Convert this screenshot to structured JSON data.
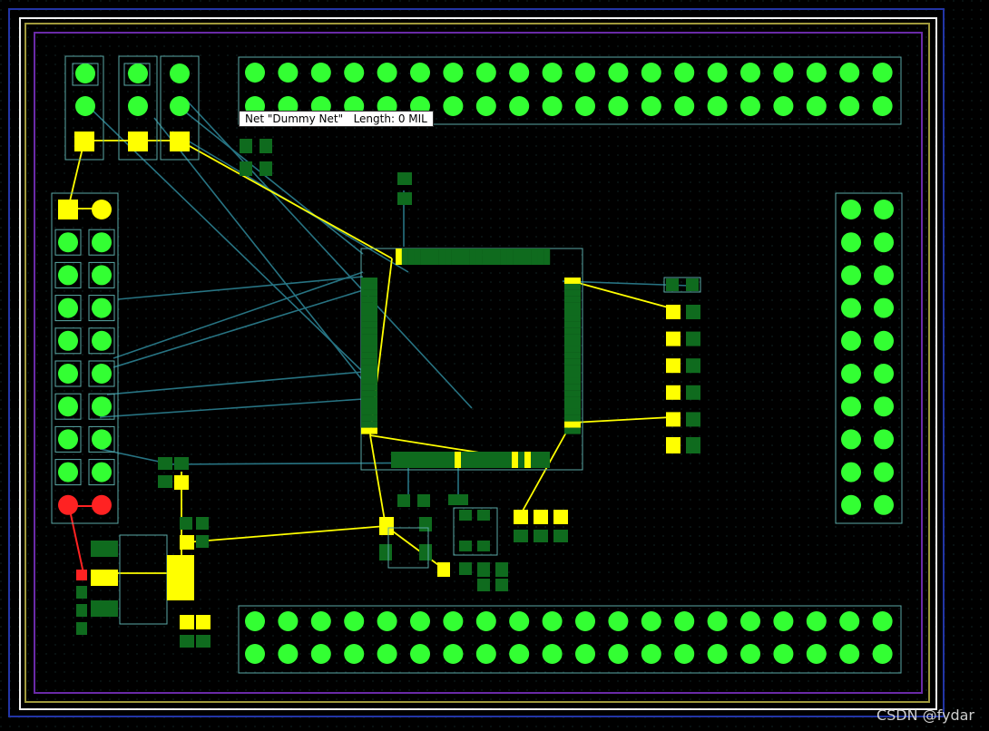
{
  "tooltip": {
    "text": "Net \"Dummy Net\"   Length: 0 MIL"
  },
  "watermark": {
    "text": "CSDN @fydar"
  },
  "colors": {
    "background": "#000000",
    "grid_dot": "#1b3b3b",
    "board_outline_white": "#f2f2f2",
    "board_outline_yellow": "#a09a3c",
    "keepout_purple": "#6a2aa8",
    "outer_blue": "#2235a6",
    "pad_green": "#33ff33",
    "pad_yellow": "#ffff00",
    "pad_red": "#ff2222",
    "smd_pad_dark_green": "#0f6b1e",
    "silkscreen_teal": "#5aa9a6",
    "ratsnest_teal": "#2a7a8a",
    "trace_yellow": "#ffff00",
    "trace_red": "#ff2222"
  },
  "icons": {
    "through_hole_pad_icon": "circle",
    "smd_pad_icon": "rect"
  }
}
